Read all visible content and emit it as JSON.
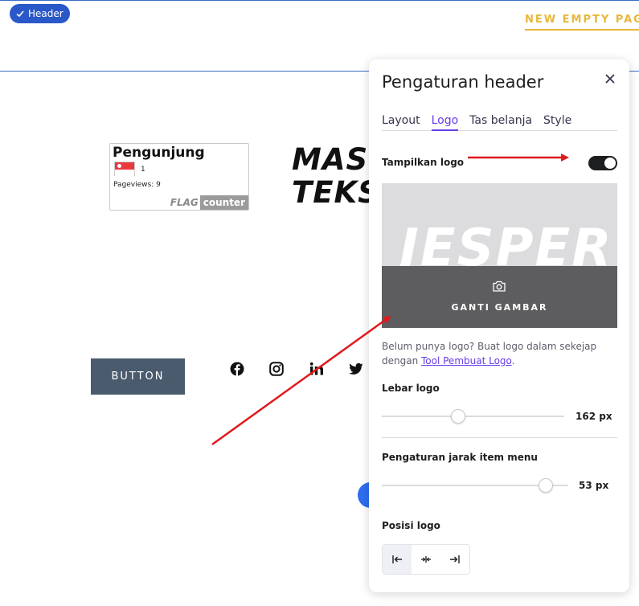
{
  "header_badge": {
    "label": "Header"
  },
  "nav": {
    "link": "NEW EMPTY PAG"
  },
  "counter": {
    "title": "Pengunjung",
    "count": "1",
    "pageviews": "Pageviews:  9",
    "brand_flag": "FLAG",
    "brand_counter": "counter"
  },
  "hero": {
    "line1": "MAS",
    "line2": "TEKS"
  },
  "button": {
    "label": "BUTTON"
  },
  "social_icons": [
    "facebook-icon",
    "instagram-icon",
    "linkedin-icon",
    "twitter-icon"
  ],
  "panel": {
    "title": "Pengaturan header",
    "tabs": [
      {
        "label": "Layout"
      },
      {
        "label": "Logo",
        "active": true
      },
      {
        "label": "Tas belanja"
      },
      {
        "label": "Style"
      }
    ],
    "show_logo": {
      "label": "Tampilkan logo",
      "enabled": true
    },
    "logo_preview": {
      "text": "JESPER",
      "change_label": "GANTI GAMBAR"
    },
    "help": {
      "text": "Belum punya logo? Buat logo dalam sekejap dengan ",
      "link": "Tool Pembuat Logo",
      "suffix": "."
    },
    "logo_width": {
      "label": "Lebar logo",
      "value": "162 px",
      "fraction": 0.42
    },
    "menu_spacing": {
      "label": "Pengaturan jarak item menu",
      "value": "53 px",
      "fraction": 0.88
    },
    "logo_position": {
      "label": "Posisi logo",
      "options": [
        "align-left-icon",
        "align-center-icon",
        "align-right-icon"
      ],
      "selected": 0
    }
  },
  "colors": {
    "accent": "#673de6",
    "badge": "#2a58c8",
    "nav_link": "#e8b73a",
    "button_bg": "#4a5b6e",
    "annotation_arrow": "#e0191b"
  }
}
